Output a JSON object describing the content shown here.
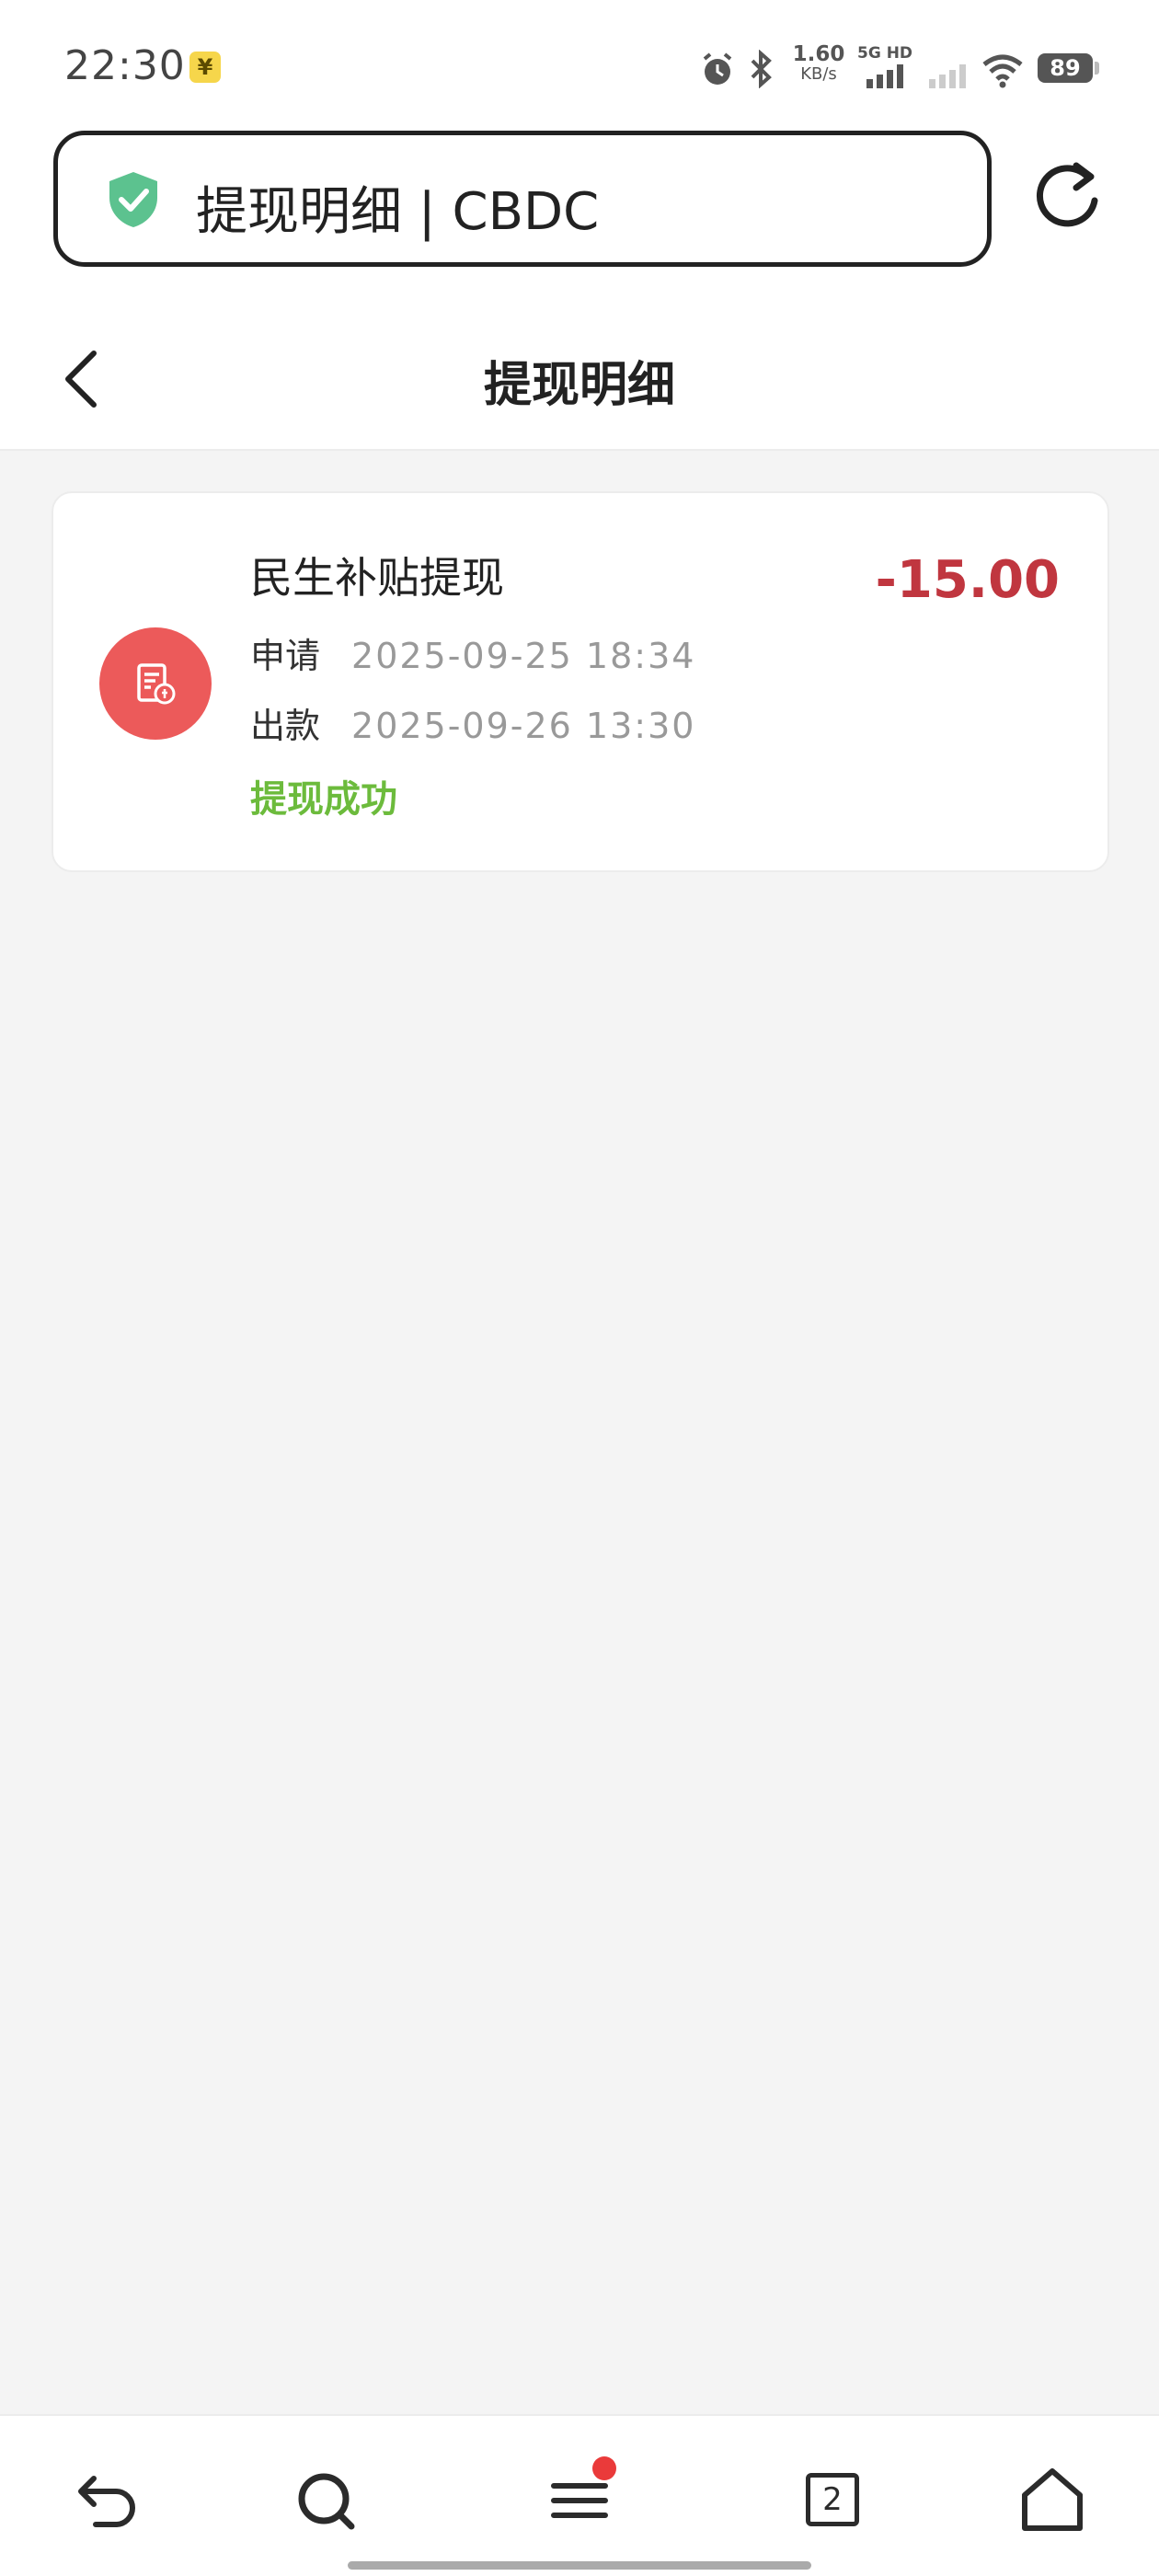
{
  "status_bar": {
    "time": "22:30",
    "yuan_badge": "¥",
    "net_speed_value": "1.60",
    "net_speed_unit": "KB/s",
    "network_label": "5G HD",
    "battery": "89",
    "icons": [
      "alarm-icon",
      "bluetooth-icon",
      "signal-icon",
      "signal-weak-icon",
      "wifi-icon",
      "battery-icon"
    ]
  },
  "browser": {
    "url_text": "提现明细 | CBDC",
    "shield_color": "#5cc28f"
  },
  "header": {
    "title": "提现明细"
  },
  "records": [
    {
      "title": "民生补贴提现",
      "amount": "-15.00",
      "apply_label": "申请",
      "apply_time": "2025-09-25  18:34",
      "payout_label": "出款",
      "payout_time": "2025-09-26  13:30",
      "status": "提现成功",
      "icon": "receipt-icon",
      "icon_color": "#ec5a5a",
      "amount_color": "#c0363f",
      "status_color": "#6cbb3c"
    }
  ],
  "bottom_nav": {
    "tab_count": "2",
    "items": [
      "back-icon",
      "search-icon",
      "menu-icon",
      "tabs-icon",
      "home-icon"
    ]
  }
}
